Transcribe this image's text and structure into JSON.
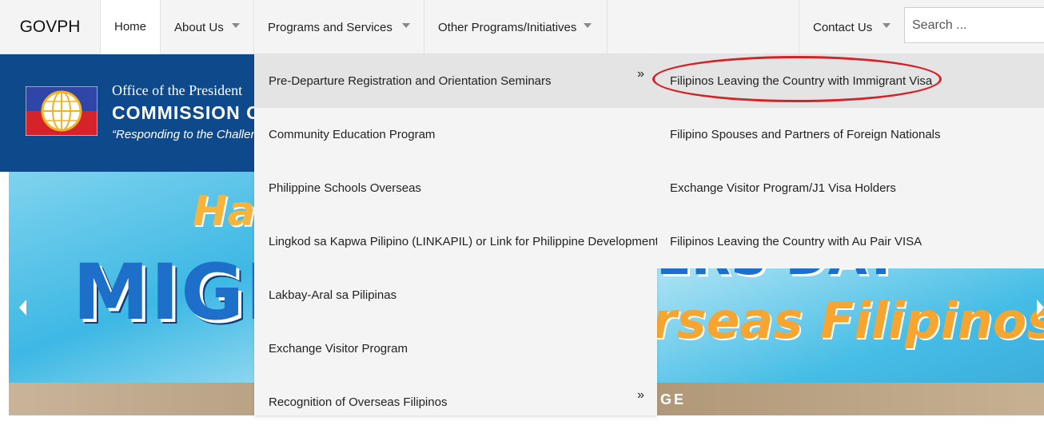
{
  "nav": {
    "brand": "GOVPH",
    "items": [
      {
        "label": "Home"
      },
      {
        "label": "About Us"
      },
      {
        "label": "Programs and Services"
      },
      {
        "label": "Other Programs/Initiatives"
      },
      {
        "label": "Contact Us"
      }
    ],
    "search_placeholder": "Search ..."
  },
  "header": {
    "office": "Office of the President",
    "commission": "COMMISSION O",
    "tagline": "“Responding to the Challen"
  },
  "slider": {
    "line1": "Ha",
    "line2": "MIGR",
    "line3": "ERS DAY",
    "line4": "rseas Filipinos",
    "band_text": "GE"
  },
  "programs_menu": {
    "items": [
      {
        "label": "Pre-Departure Registration and Orientation Seminars",
        "arrow": "»"
      },
      {
        "label": "Community Education Program"
      },
      {
        "label": "Philippine Schools Overseas"
      },
      {
        "label": "Lingkod sa Kapwa Pilipino (LINKAPIL) or Link for Philippine Development"
      },
      {
        "label": "Lakbay-Aral sa Pilipinas"
      },
      {
        "label": "Exchange Visitor Program"
      },
      {
        "label": "Recognition of Overseas Filipinos",
        "arrow": "»"
      }
    ]
  },
  "submenu": {
    "items": [
      {
        "label": "Filipinos Leaving the Country with Immigrant Visa"
      },
      {
        "label": "Filipino Spouses and Partners of Foreign Nationals"
      },
      {
        "label": "Exchange Visitor Program/J1 Visa Holders"
      },
      {
        "label": "Filipinos Leaving the Country with Au Pair VISA"
      }
    ]
  },
  "colors": {
    "header_bg": "#0e4a8b",
    "annotation_oval": "#d42328",
    "menu_bg": "#f4f4f4",
    "menu_active_bg": "#e4e4e4"
  }
}
